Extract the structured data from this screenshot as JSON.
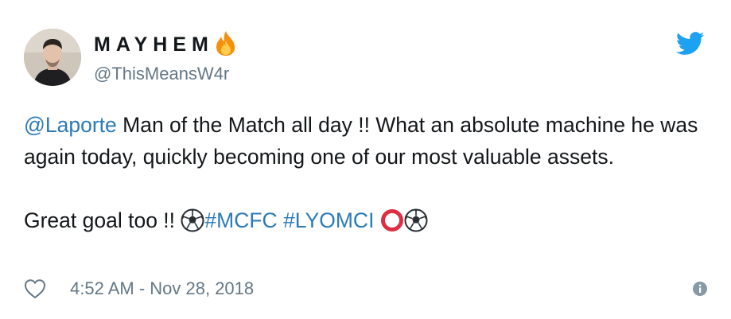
{
  "author": {
    "display_name": "MAYHEM",
    "handle": "@ThisMeansW4r",
    "avatar_icon": "profile-photo",
    "name_emoji": "fire-icon"
  },
  "tweet": {
    "mention": "@Laporte",
    "line1_rest": " Man of the Match all day !! What an absolute machine he was again today, quickly becoming one of our most valuable assets.",
    "line2_text": "Great goal too !! ",
    "hashtag1": "#MCFC",
    "hashtag2": "#LYOMCI",
    "separator": " ",
    "emojis": [
      "soccer-ball-icon",
      "hollow-red-circle-icon",
      "soccer-ball-icon"
    ]
  },
  "footer": {
    "timestamp": "4:52 AM - Nov 28, 2018",
    "like_icon": "heart-icon",
    "info_icon": "info-icon"
  },
  "brand": {
    "logo": "twitter-bird-icon",
    "twitter_blue": "#1da1f2",
    "link_color": "#2b7bb9",
    "muted_text": "#657786"
  }
}
